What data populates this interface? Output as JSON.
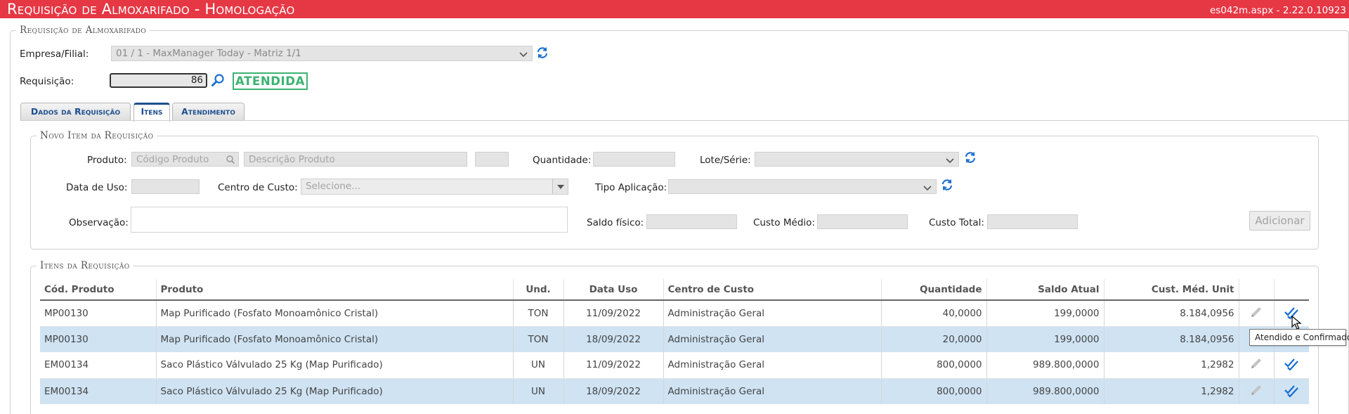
{
  "window": {
    "title": "Requisição de Almoxarifado  - Homologação",
    "version": "es042m.aspx - 2.22.0.10923"
  },
  "main_section": {
    "legend": "Requisição de Almoxarifado",
    "empresa_label": "Empresa/Filial:",
    "empresa_value": "01 / 1 - MaxManager Today - Matriz 1/1",
    "requisicao_label": "Requisição:",
    "requisicao_value": "86",
    "status": "ATENDIDA"
  },
  "tabs": [
    {
      "label": "Dados da Requisição"
    },
    {
      "label": "Itens"
    },
    {
      "label": "Atendimento"
    }
  ],
  "novo_item": {
    "legend": "Novo Item da Requisição",
    "produto_label": "Produto:",
    "codigo_placeholder": "Código Produto",
    "descricao_placeholder": "Descrição Produto",
    "quantidade_label": "Quantidade:",
    "lote_label": "Lote/Série:",
    "data_uso_label": "Data de Uso:",
    "centro_label": "Centro de Custo:",
    "centro_placeholder": "Selecione...",
    "tipo_label": "Tipo Aplicação:",
    "observacao_label": "Observação:",
    "saldo_label": "Saldo físico:",
    "custo_medio_label": "Custo Médio:",
    "custo_total_label": "Custo Total:",
    "add_label": "Adicionar"
  },
  "itens": {
    "legend": "Itens da Requisição",
    "columns": [
      "Cód. Produto",
      "Produto",
      "Und.",
      "Data Uso",
      "Centro de Custo",
      "Quantidade",
      "Saldo Atual",
      "Cust. Méd. Unit"
    ],
    "rows": [
      [
        "MP00130",
        "Map Purificado (Fosfato Monoamônico Cristal)",
        "TON",
        "11/09/2022",
        "Administração Geral",
        "40,0000",
        "199,0000",
        "8.184,0956"
      ],
      [
        "MP00130",
        "Map Purificado (Fosfato Monoamônico Cristal)",
        "TON",
        "18/09/2022",
        "Administração Geral",
        "20,0000",
        "199,0000",
        "8.184,0956"
      ],
      [
        "EM00134",
        "Saco Plástico Válvulado 25 Kg (Map Purificado)",
        "UN",
        "11/09/2022",
        "Administração Geral",
        "800,0000",
        "989.800,0000",
        "1,2982"
      ],
      [
        "EM00134",
        "Saco Plástico Válvulado 25 Kg (Map Purificado)",
        "UN",
        "18/09/2022",
        "Administração Geral",
        "800,0000",
        "989.800,0000",
        "1,2982"
      ]
    ]
  },
  "tooltip": "Atendido e Confirmado",
  "icons": {
    "refresh": "refresh-icon",
    "search": "search-icon",
    "edit": "pencil-icon",
    "confirmed": "double-check-icon"
  },
  "colors": {
    "titlebar": "#e63744",
    "status": "#3cb371",
    "tab_text": "#1d4f8f",
    "row_alt": "#cfe3f3",
    "icon_blue": "#1c6fd1"
  }
}
